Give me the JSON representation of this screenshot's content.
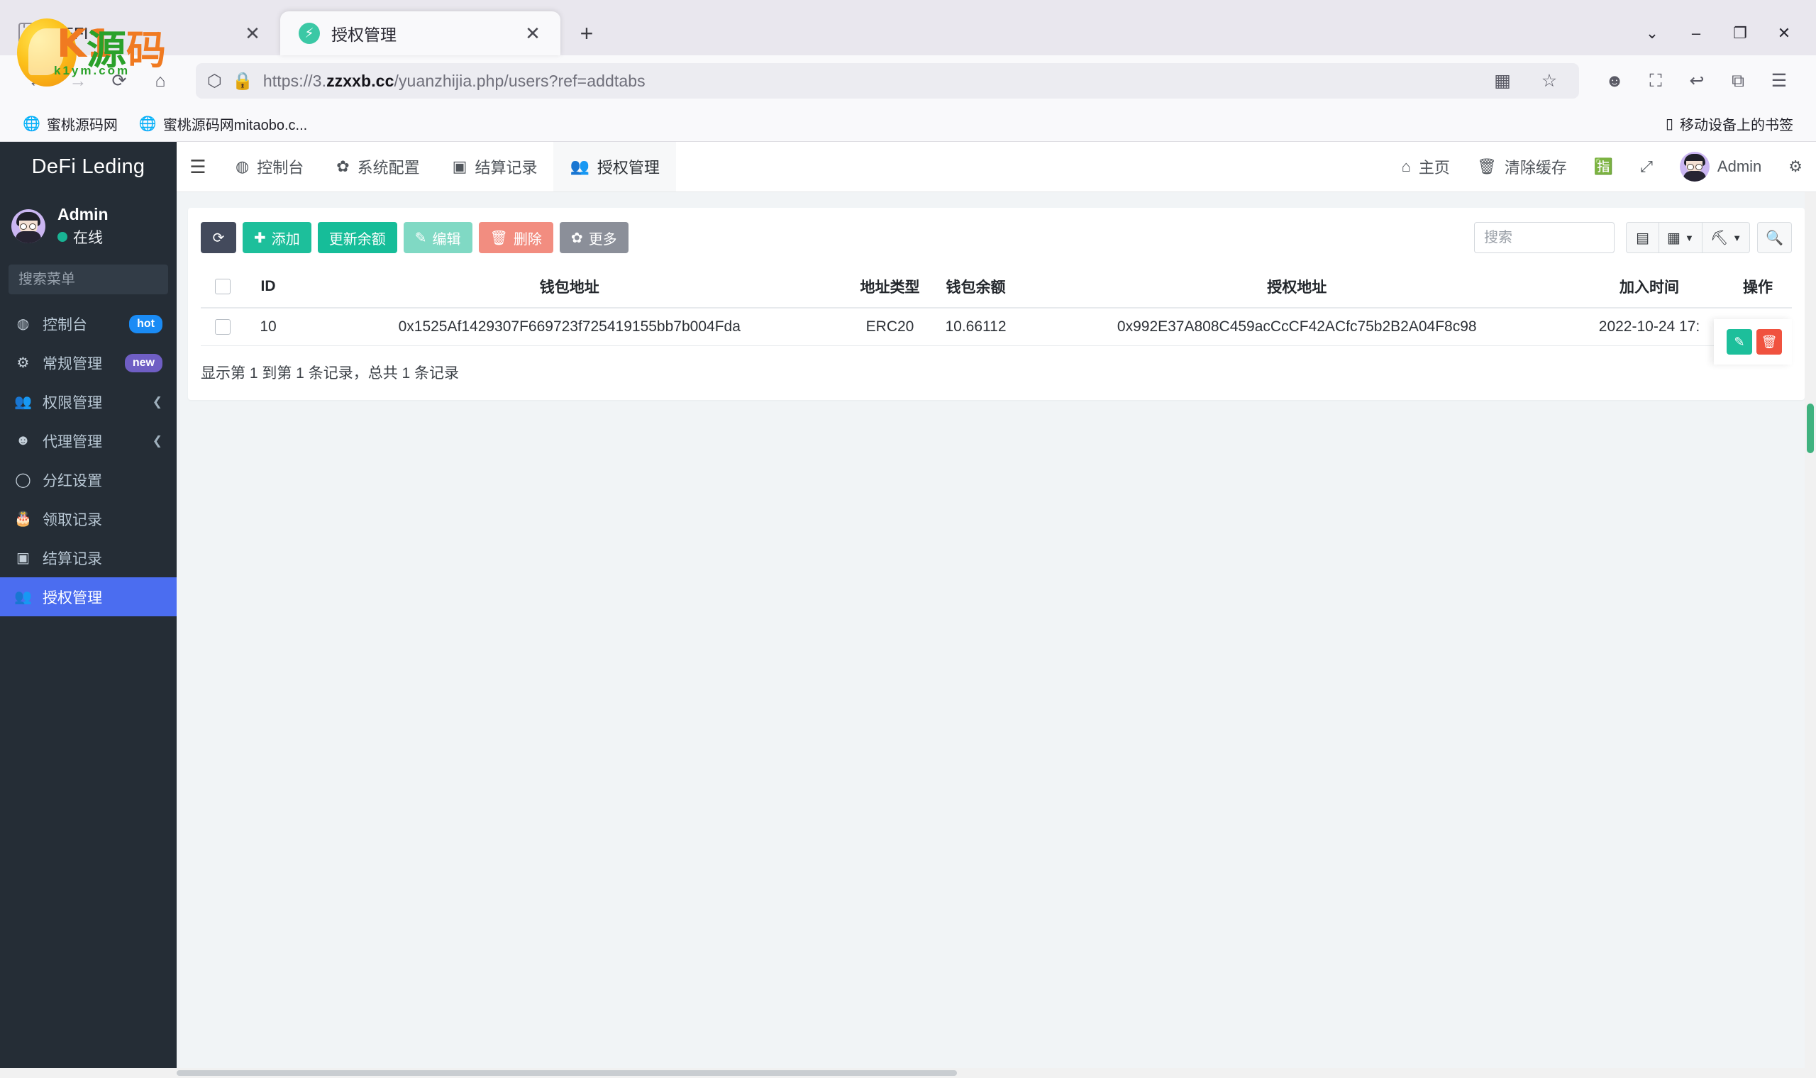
{
  "browser": {
    "tabs": [
      {
        "title": "DEFI",
        "active": false,
        "favicon": "generic-page-icon"
      },
      {
        "title": "授权管理",
        "active": true,
        "favicon": "lightning-bolt-icon"
      }
    ],
    "new_tab_label": "+",
    "window_controls": {
      "list_all_tabs": "⌄",
      "minimize": "–",
      "maximize": "❐",
      "close": "✕"
    },
    "url": {
      "scheme": "https://3.",
      "domain": "zzxxb.cc",
      "path": "/yuanzhijia.php/users?ref=addtabs",
      "full": "https://3.zzxxb.cc/yuanzhijia.php/users?ref=addtabs"
    },
    "bookmarks": [
      {
        "label": "蜜桃源码网",
        "icon": "globe-icon"
      },
      {
        "label": "蜜桃源码网mitaobo.c...",
        "icon": "globe-icon"
      }
    ],
    "bookmarks_right": {
      "label": "移动设备上的书签",
      "icon": "mobile-device-icon"
    }
  },
  "sidebar": {
    "brand": "DeFi Leding",
    "user": {
      "name": "Admin",
      "status": "在线"
    },
    "search": {
      "placeholder": "搜索菜单",
      "value": ""
    },
    "items": [
      {
        "label": "控制台",
        "icon": "dashboard-icon",
        "badge": "hot",
        "badge_color": "#1a8bf5",
        "active": false,
        "expandable": false
      },
      {
        "label": "常规管理",
        "icon": "gears-icon",
        "badge": "new",
        "badge_color": "#6f5ec4",
        "active": false,
        "expandable": false
      },
      {
        "label": "权限管理",
        "icon": "users-icon",
        "badge": "",
        "active": false,
        "expandable": true
      },
      {
        "label": "代理管理",
        "icon": "user-circle-icon",
        "badge": "",
        "active": false,
        "expandable": true
      },
      {
        "label": "分红设置",
        "icon": "circle-icon",
        "badge": "",
        "active": false,
        "expandable": false
      },
      {
        "label": "领取记录",
        "icon": "cake-icon",
        "badge": "",
        "active": false,
        "expandable": false
      },
      {
        "label": "结算记录",
        "icon": "os-box-icon",
        "badge": "",
        "active": false,
        "expandable": false
      },
      {
        "label": "授权管理",
        "icon": "users-icon",
        "badge": "",
        "active": true,
        "expandable": false
      }
    ]
  },
  "topnav": {
    "menu_toggle": "hamburger-icon",
    "tabs": [
      {
        "label": "控制台",
        "icon": "dashboard-icon",
        "active": false
      },
      {
        "label": "系统配置",
        "icon": "gear-icon",
        "active": false
      },
      {
        "label": "结算记录",
        "icon": "os-box-icon",
        "active": false
      },
      {
        "label": "授权管理",
        "icon": "users-icon",
        "active": true
      }
    ],
    "right": [
      {
        "label": "主页",
        "icon": "home-icon"
      },
      {
        "label": "清除缓存",
        "icon": "trash-icon"
      },
      {
        "label": "",
        "icon": "language-icon"
      },
      {
        "label": "",
        "icon": "fullscreen-icon"
      },
      {
        "label": "Admin",
        "icon": "avatar-icon"
      },
      {
        "label": "",
        "icon": "settings-gears-icon"
      }
    ]
  },
  "toolbar": {
    "refresh": {
      "label": "",
      "icon": "refresh-icon",
      "color": "#434a5c"
    },
    "buttons": [
      {
        "label": "添加",
        "icon": "plus-icon",
        "color": "#1dbf9b"
      },
      {
        "label": "更新余额",
        "icon": "",
        "color": "#16bd99"
      },
      {
        "label": "编辑",
        "icon": "pencil-icon",
        "color": "#80d9c4"
      },
      {
        "label": "删除",
        "icon": "trash-icon",
        "color": "#f28d80"
      },
      {
        "label": "更多",
        "icon": "gear-icon",
        "color": "#8b8f99"
      }
    ],
    "search": {
      "placeholder": "搜索",
      "value": ""
    },
    "icon_buttons": [
      {
        "icon": "list-view-icon",
        "caret": false
      },
      {
        "icon": "grid-columns-icon",
        "caret": true
      },
      {
        "icon": "export-icon",
        "caret": true
      }
    ],
    "search_button": {
      "icon": "search-icon"
    }
  },
  "table": {
    "columns": [
      "",
      "ID",
      "钱包地址",
      "地址类型",
      "钱包余额",
      "授权地址",
      "加入时间",
      "操作"
    ],
    "rows": [
      {
        "id": "10",
        "wallet_address": "0x1525Af1429307F669723f725419155bb7b004Fda",
        "address_type": "ERC20",
        "balance": "10.66112",
        "auth_address": "0x992E37A808C459acCcCF42ACfc75b2B2A04F8c98",
        "join_time": "2022-10-24 17:",
        "actions": [
          {
            "icon": "pencil-icon",
            "color": "#1dbf9b"
          },
          {
            "icon": "trash-icon",
            "color": "#f0523f"
          }
        ]
      }
    ],
    "footer": "显示第 1 到第 1 条记录，总共 1 条记录"
  },
  "watermark": {
    "k": "K1",
    "y": "源",
    "m": "码",
    "sub": "k1ym.com"
  }
}
